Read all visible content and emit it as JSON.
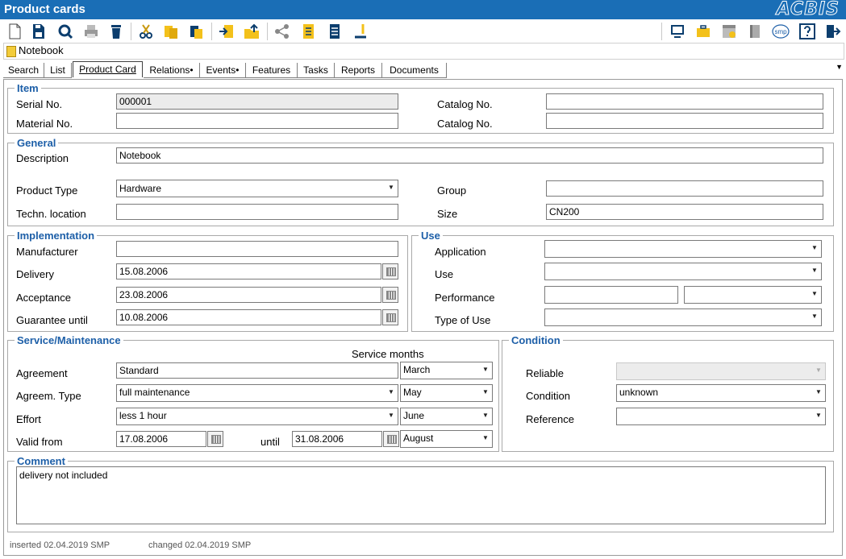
{
  "window": {
    "title": "Product cards",
    "brand": "ACBIS"
  },
  "toolbar": {
    "left_icons": [
      "new-icon",
      "save-icon",
      "search-icon",
      "print-icon",
      "delete-icon",
      "cut-icon",
      "copy-icon",
      "paste-icon",
      "import-icon",
      "export-icon",
      "share-icon",
      "document-icon",
      "list-icon",
      "edit-icon"
    ],
    "right_icons": [
      "monitor-icon",
      "briefcase-icon",
      "calendar-icon",
      "book-icon",
      "smp-icon",
      "help-icon",
      "exit-icon"
    ],
    "smp_label": "smp"
  },
  "record": {
    "title": "Notebook"
  },
  "tabs": [
    "Search",
    "List",
    "Product Card",
    "Relations•",
    "Events•",
    "Features",
    "Tasks",
    "Reports",
    "Documents"
  ],
  "item": {
    "legend": "Item",
    "serial_label": "Serial No.",
    "serial_value": "000001",
    "material_label": "Material No.",
    "material_value": "",
    "catalog1_label": "Catalog No.",
    "catalog1_value": "",
    "catalog2_label": "Catalog No.",
    "catalog2_value": ""
  },
  "general": {
    "legend": "General",
    "description_label": "Description",
    "description_value": "Notebook",
    "product_type_label": "Product Type",
    "product_type_value": "Hardware",
    "techn_location_label": "Techn. location",
    "techn_location_value": "",
    "group_label": "Group",
    "group_value": "",
    "size_label": "Size",
    "size_value": "CN200"
  },
  "implementation": {
    "legend": "Implementation",
    "manufacturer_label": "Manufacturer",
    "manufacturer_value": "",
    "delivery_label": "Delivery",
    "delivery_value": "15.08.2006",
    "acceptance_label": "Acceptance",
    "acceptance_value": "23.08.2006",
    "guarantee_label": "Guarantee until",
    "guarantee_value": "10.08.2006"
  },
  "use": {
    "legend": "Use",
    "application_label": "Application",
    "application_value": "",
    "use_label": "Use",
    "use_value": "",
    "performance_label": "Performance",
    "performance_value": "",
    "performance_unit": "",
    "type_of_use_label": "Type of Use",
    "type_of_use_value": ""
  },
  "service": {
    "legend": "Service/Maintenance",
    "service_months_label": "Service months",
    "agreement_label": "Agreement",
    "agreement_value": "Standard",
    "month1": "March",
    "agreem_type_label": "Agreem. Type",
    "agreem_type_value": "full maintenance",
    "month2": "May",
    "effort_label": "Effort",
    "effort_value": "less 1 hour",
    "month3": "June",
    "valid_from_label": "Valid from",
    "valid_from_value": "17.08.2006",
    "until_label": "until",
    "until_value": "31.08.2006",
    "month4": "August"
  },
  "condition": {
    "legend": "Condition",
    "reliable_label": "Reliable",
    "reliable_value": "",
    "condition_label": "Condition",
    "condition_value": "unknown",
    "reference_label": "Reference",
    "reference_value": ""
  },
  "comment": {
    "legend": "Comment",
    "value": "delivery not included"
  },
  "footer": {
    "inserted": "inserted   02.04.2019  SMP",
    "changed": "changed 02.04.2019  SMP"
  }
}
